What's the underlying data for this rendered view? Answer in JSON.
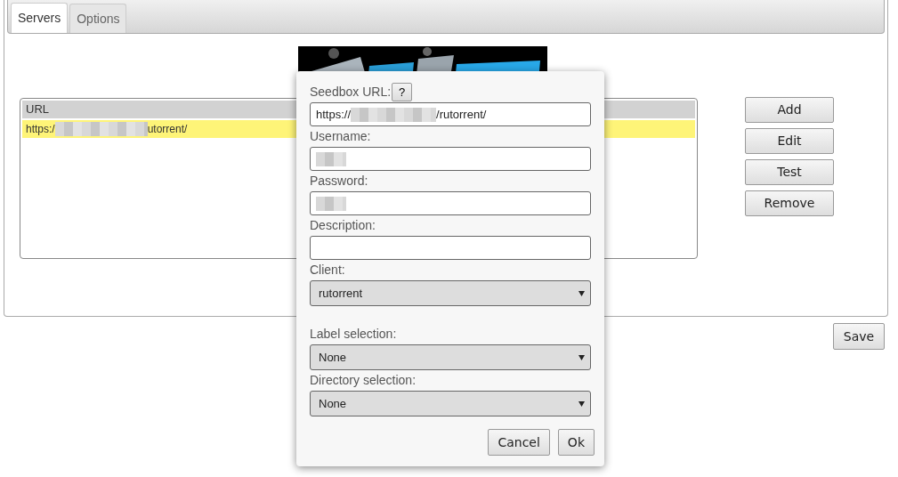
{
  "tabs": [
    {
      "label": "Servers",
      "selected": true
    },
    {
      "label": "Options",
      "selected": false
    }
  ],
  "logo": {
    "kind": "picture"
  },
  "server_list": {
    "columns": [
      "URL"
    ],
    "rows": [
      {
        "url_start": "https:/",
        "url_redacted": true,
        "url_end": "utorrent/",
        "selected": true
      }
    ]
  },
  "side_buttons": [
    "Add",
    "Edit",
    "Test",
    "Remove"
  ],
  "save_button": "Save",
  "dialog": {
    "fields": [
      {
        "kind": "text",
        "label": "Seedbox URL:",
        "help_button": "?",
        "value_start": "https://",
        "redacted": true,
        "value_end": "/rutorrent/"
      },
      {
        "kind": "text",
        "label": "Username:",
        "redacted": true
      },
      {
        "kind": "text",
        "label": "Password:",
        "redacted": true
      },
      {
        "kind": "text",
        "label": "Description:"
      },
      {
        "kind": "select",
        "label": "Client:",
        "value": "rutorrent"
      }
    ],
    "selection_fields": [
      {
        "kind": "select",
        "label": "Label selection:",
        "value": "None"
      },
      {
        "kind": "select",
        "label": "Directory selection:",
        "value": "None"
      }
    ],
    "buttons": [
      "Cancel",
      "Ok"
    ]
  }
}
